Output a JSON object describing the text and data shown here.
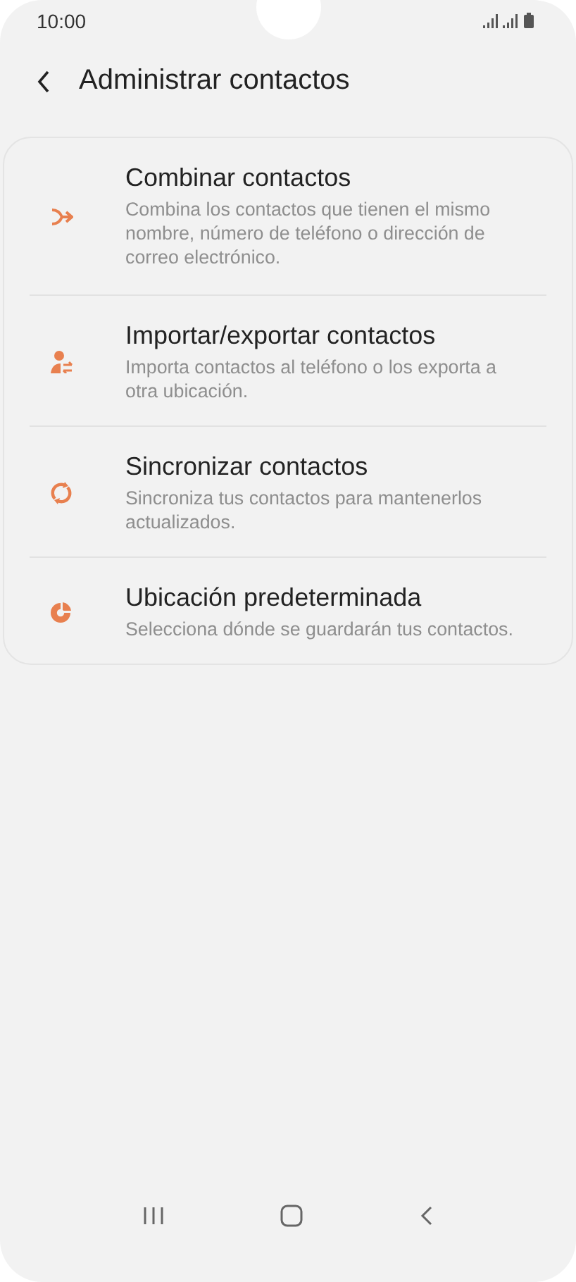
{
  "status_bar": {
    "time": "10:00"
  },
  "header": {
    "title": "Administrar contactos"
  },
  "items": [
    {
      "kind": "merge",
      "title": "Combinar contactos",
      "description": "Combina los contactos que tienen el mismo nombre, número de teléfono o dirección de correo electrónico."
    },
    {
      "kind": "import-export",
      "title": "Importar/exportar contactos",
      "description": "Importa contactos al teléfono o los exporta a otra ubicación."
    },
    {
      "kind": "sync",
      "title": "Sincronizar contactos",
      "description": "Sincroniza tus contactos para mantenerlos actualizados."
    },
    {
      "kind": "storage",
      "title": "Ubicación predeterminada",
      "description": "Selecciona dónde se guardarán tus contactos."
    }
  ]
}
